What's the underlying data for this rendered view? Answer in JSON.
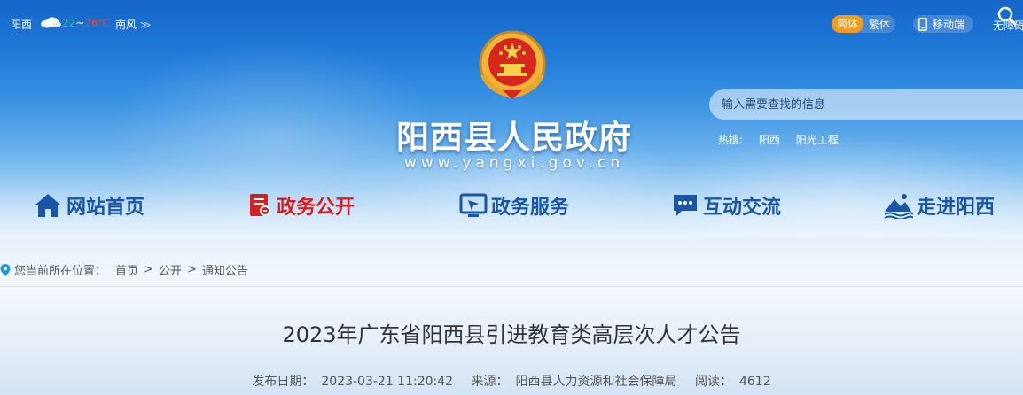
{
  "colors": {
    "accent_blue": "#1a56a6",
    "active_red": "#d42020",
    "lang_orange": "#f39a1d",
    "temp_low_green": "#2ec76a",
    "temp_high_red": "#e2423a"
  },
  "topbar": {
    "location": "阳西",
    "weather_icon": "cloud-icon",
    "temp_low": "22",
    "temp_sep": "~",
    "temp_high": "26℃",
    "wind": "南风",
    "lang_simplified": "简体",
    "lang_traditional": "繁体",
    "mobile_label": "移动端",
    "accessibility_label": "无障碍"
  },
  "header": {
    "emblem_icon": "national-emblem",
    "site_title": "阳西县人民政府",
    "site_url": "www.yangxi.gov.cn"
  },
  "search": {
    "placeholder": "输入需要查找的信息",
    "hot_label": "热搜:",
    "hot_items": [
      "阳西",
      "阳光工程"
    ]
  },
  "nav": {
    "items": [
      {
        "label": "网站首页",
        "icon": "home-icon"
      },
      {
        "label": "政务公开",
        "icon": "document-icon"
      },
      {
        "label": "政务服务",
        "icon": "service-screen-icon"
      },
      {
        "label": "互动交流",
        "icon": "chat-icon"
      },
      {
        "label": "走进阳西",
        "icon": "landscape-icon"
      }
    ],
    "active_index": 1
  },
  "breadcrumb": {
    "prefix": "您当前所在位置：",
    "items": [
      "首页",
      "公开",
      "通知公告"
    ],
    "separator": ">"
  },
  "article": {
    "title": "2023年广东省阳西县引进教育类高层次人才公告",
    "publish_label": "发布日期：",
    "publish_date": "2023-03-21 11:20:42",
    "source_label": "来源：",
    "source": "阳西县人力资源和社会保障局",
    "views_label": "阅读：",
    "views": "4612"
  }
}
